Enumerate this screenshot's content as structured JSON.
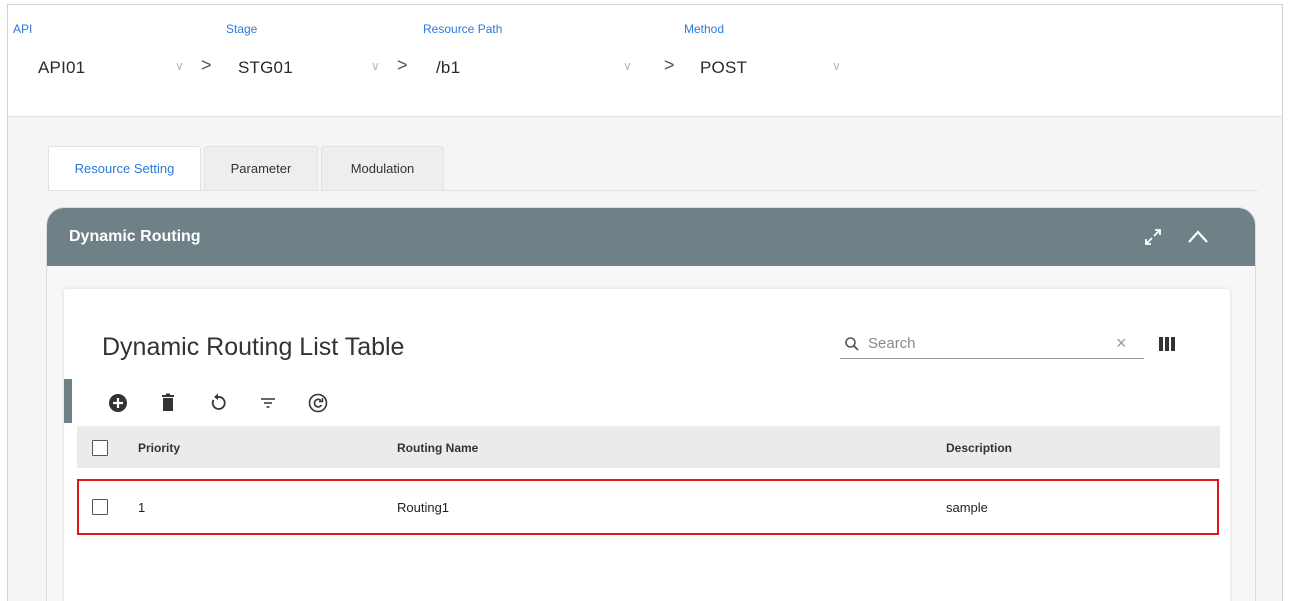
{
  "breadcrumb": [
    {
      "label": "API",
      "value": "API01"
    },
    {
      "label": "Stage",
      "value": "STG01"
    },
    {
      "label": "Resource Path",
      "value": "/b1"
    },
    {
      "label": "Method",
      "value": "POST"
    }
  ],
  "separator": ">",
  "dropdown_glyph": "∨",
  "tabs": [
    {
      "label": "Resource Setting",
      "active": true
    },
    {
      "label": "Parameter",
      "active": false
    },
    {
      "label": "Modulation",
      "active": false
    }
  ],
  "panel": {
    "title": "Dynamic Routing",
    "header_color": "#6f8186",
    "icons": [
      "expand-icon",
      "chevron-up-icon"
    ]
  },
  "table": {
    "title": "Dynamic Routing List Table",
    "search": {
      "placeholder": "Search",
      "value": ""
    },
    "clear_glyph": "×",
    "toolbar_icons": [
      "add-circle-icon",
      "trash-icon",
      "refresh-icon",
      "filter-icon",
      "reset-circle-icon"
    ],
    "columns": [
      "Priority",
      "Routing Name",
      "Description"
    ],
    "rows": [
      {
        "priority": "1",
        "routing_name": "Routing1",
        "description": "sample",
        "highlighted": true
      }
    ],
    "highlight_color": "#e0161e"
  },
  "accent_color": "#2b7ad8"
}
